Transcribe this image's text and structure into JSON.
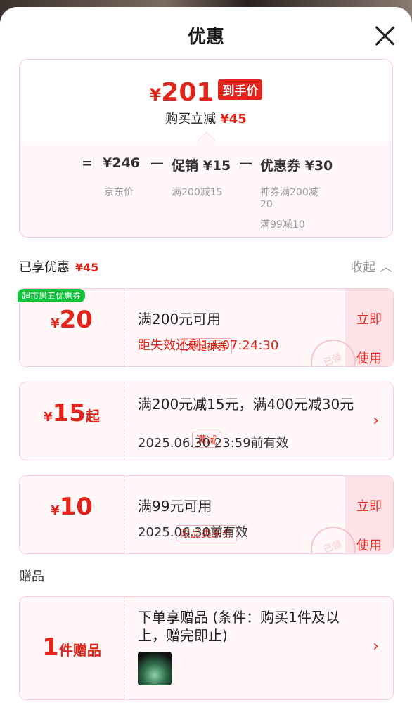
{
  "header": {
    "title": "优惠"
  },
  "summary": {
    "currency": "¥",
    "final_price": "201",
    "final_tag": "到手价",
    "reduce_label": "购买立减",
    "reduce_amount": "¥45",
    "eq": "=",
    "base_price": "¥246",
    "base_label": "京东价",
    "minus1": "—",
    "promo": "促销 ¥15",
    "promo_detail": "满200减15",
    "minus2": "—",
    "coupon": "优惠券 ¥30",
    "coupon_detail_1": "神券满200减",
    "coupon_detail_1b": "20",
    "coupon_detail_2": "满99减10"
  },
  "enjoyed": {
    "label": "已享优惠",
    "amount": "¥45",
    "collapse": "收起"
  },
  "coupons": [
    {
      "badge": "超市黑五优惠券",
      "currency": "¥",
      "amount": "20",
      "suffix": "",
      "type": "大促神券",
      "condition": "满200元可用",
      "detail": "距失效还剩1天07:24:30",
      "action_1": "立即",
      "action_2": "使用",
      "stamp": "已领"
    },
    {
      "currency": "¥",
      "amount": "15",
      "suffix": "起",
      "type": "满减",
      "condition": "满200元减15元，满400元减30元",
      "detail": "2025.06.30 23:59前有效",
      "arrow": "›"
    },
    {
      "currency": "¥",
      "amount": "10",
      "suffix": "",
      "type": "限品类东券",
      "condition": "满99元可用",
      "detail": "2025.06.30前有效",
      "action_1": "立即",
      "action_2": "使用",
      "stamp": "已领"
    }
  ],
  "gift": {
    "section": "赠品",
    "count": "1",
    "unit": "件赠品",
    "text": "下单享赠品 (条件：购买1件及以上，赠完即止)",
    "arrow": "›"
  }
}
